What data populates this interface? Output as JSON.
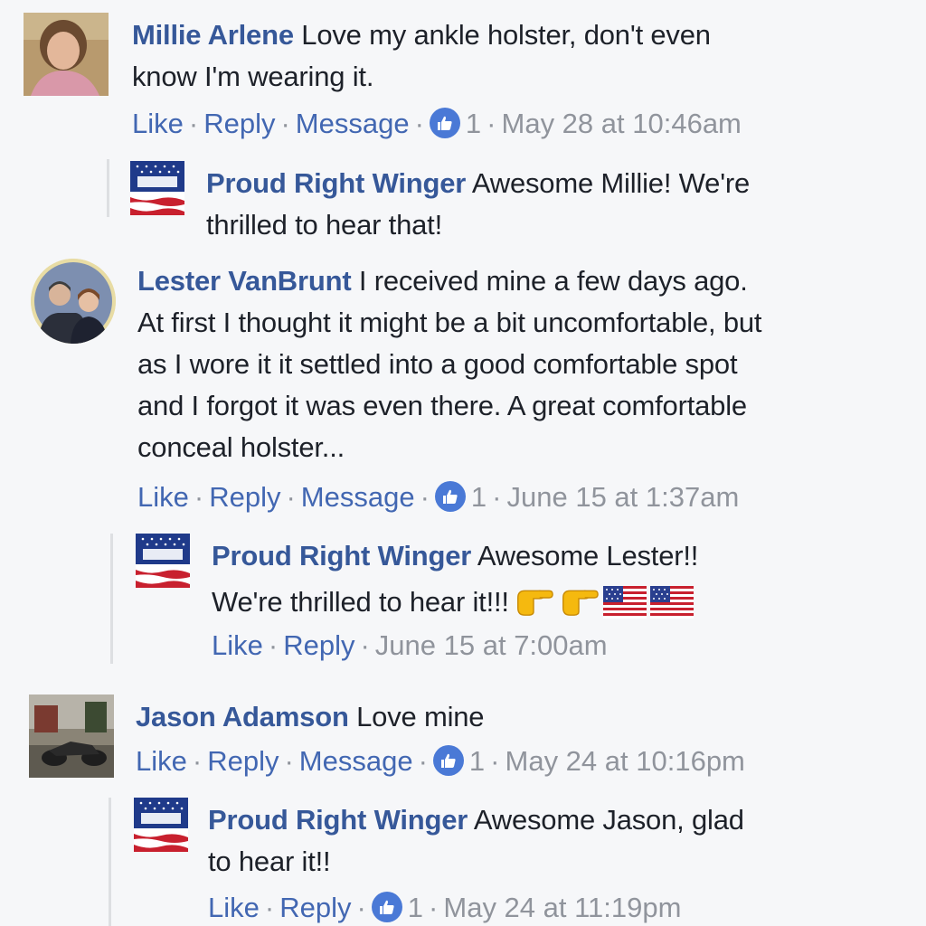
{
  "comments": [
    {
      "author": "Millie Arlene",
      "text_line1": " Love my ankle holster, don't even",
      "text_line2": "know I'm wearing it.",
      "actions": {
        "like": "Like",
        "reply": "Reply",
        "message": "Message",
        "like_count": "1",
        "timestamp": "May 28 at 10:46am"
      },
      "reply": {
        "author": "Proud Right Winger",
        "text_line1": " Awesome Millie! We're",
        "text_line2": "thrilled to hear that!"
      }
    },
    {
      "author": "Lester VanBrunt",
      "text_line1": " I received mine a few days ago.",
      "text_line2": "At first I thought it might be a bit uncomfortable, but",
      "text_line3": "as I wore it it settled into a good comfortable spot",
      "text_line4": "and I forgot it was even there. A great comfortable",
      "text_line5": "conceal holster...",
      "actions": {
        "like": "Like",
        "reply": "Reply",
        "message": "Message",
        "like_count": "1",
        "timestamp": "June 15 at 1:37am"
      },
      "reply": {
        "author": "Proud Right Winger",
        "text_line1": " Awesome Lester!!",
        "text_line2": "We're thrilled to hear it!!!",
        "emojis": [
          "thumbs-right",
          "thumbs-right",
          "us-flag",
          "us-flag"
        ],
        "actions": {
          "like": "Like",
          "reply": "Reply",
          "timestamp": "June 15 at 7:00am"
        }
      }
    },
    {
      "author": "Jason Adamson",
      "text_line1": " Love mine",
      "actions": {
        "like": "Like",
        "reply": "Reply",
        "message": "Message",
        "like_count": "1",
        "timestamp": "May 24 at 10:16pm"
      },
      "reply": {
        "author": "Proud Right Winger",
        "text_line1": " Awesome Jason, glad",
        "text_line2": "to hear it!!",
        "actions": {
          "like": "Like",
          "reply": "Reply",
          "like_count": "1",
          "timestamp": "May 24 at 11:19pm"
        }
      }
    }
  ],
  "colors": {
    "author": "#365899",
    "action_link": "#4267b2",
    "meta": "#90949c",
    "like_badge": "#4a79d6",
    "background": "#f6f7f9"
  }
}
